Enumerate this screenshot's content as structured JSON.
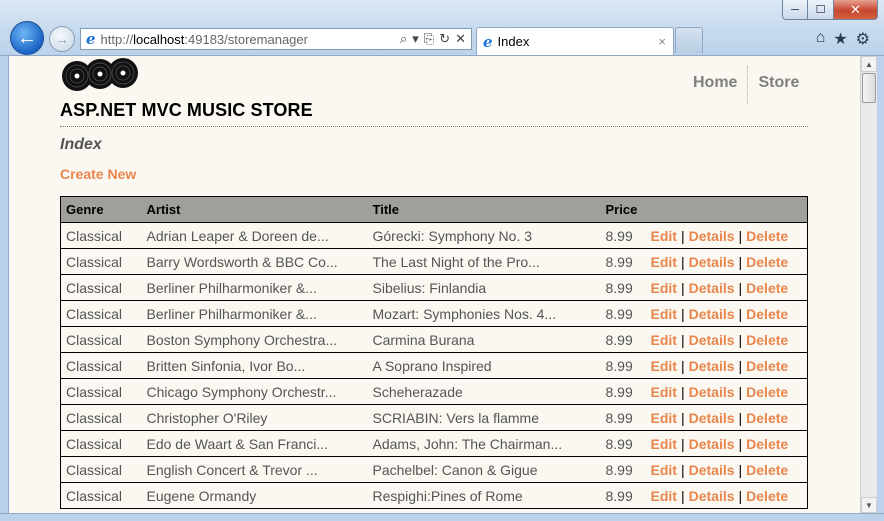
{
  "browser": {
    "url_prefix": "http://",
    "url_host": "localhost",
    "url_rest": ":49183/storemanager",
    "tab_title": "Index",
    "min_label": "─",
    "max_label": "☐",
    "close_label": "✕",
    "back_glyph": "←",
    "fwd_glyph": "→",
    "ie_glyph": "e",
    "tab_close_glyph": "×",
    "addr_tools": {
      "search": "⌕",
      "dropdown": "▾",
      "compat": "⎘",
      "refresh": "↻",
      "stop": "✕"
    },
    "tool_icons": {
      "home": "⌂",
      "favorites": "★",
      "settings": "⚙"
    }
  },
  "site": {
    "title": "ASP.NET MVC MUSIC STORE",
    "nav": [
      "Home",
      "Store"
    ],
    "page_heading": "Index",
    "create_link": "Create New"
  },
  "table": {
    "headers": [
      "Genre",
      "Artist",
      "Title",
      "Price",
      ""
    ],
    "actions": [
      "Edit",
      "Details",
      "Delete"
    ],
    "rows": [
      [
        "Classical",
        "Adrian Leaper & Doreen de...",
        "Górecki: Symphony No. 3",
        "8.99"
      ],
      [
        "Classical",
        "Barry Wordsworth & BBC Co...",
        "The Last Night of the Pro...",
        "8.99"
      ],
      [
        "Classical",
        "Berliner Philharmoniker &...",
        "Sibelius: Finlandia",
        "8.99"
      ],
      [
        "Classical",
        "Berliner Philharmoniker &...",
        "Mozart: Symphonies Nos. 4...",
        "8.99"
      ],
      [
        "Classical",
        "Boston Symphony Orchestra...",
        "Carmina Burana",
        "8.99"
      ],
      [
        "Classical",
        "Britten Sinfonia, Ivor Bo...",
        "A Soprano Inspired",
        "8.99"
      ],
      [
        "Classical",
        "Chicago Symphony Orchestr...",
        "Scheherazade",
        "8.99"
      ],
      [
        "Classical",
        "Christopher O'Riley",
        "SCRIABIN: Vers la flamme",
        "8.99"
      ],
      [
        "Classical",
        "Edo de Waart & San Franci...",
        "Adams, John: The Chairman...",
        "8.99"
      ],
      [
        "Classical",
        "English Concert & Trevor ...",
        "Pachelbel: Canon & Gigue",
        "8.99"
      ],
      [
        "Classical",
        "Eugene Ormandy",
        "Respighi:Pines of Rome",
        "8.99"
      ]
    ]
  },
  "scrollbar": {
    "up_glyph": "▲",
    "down_glyph": "▼"
  }
}
